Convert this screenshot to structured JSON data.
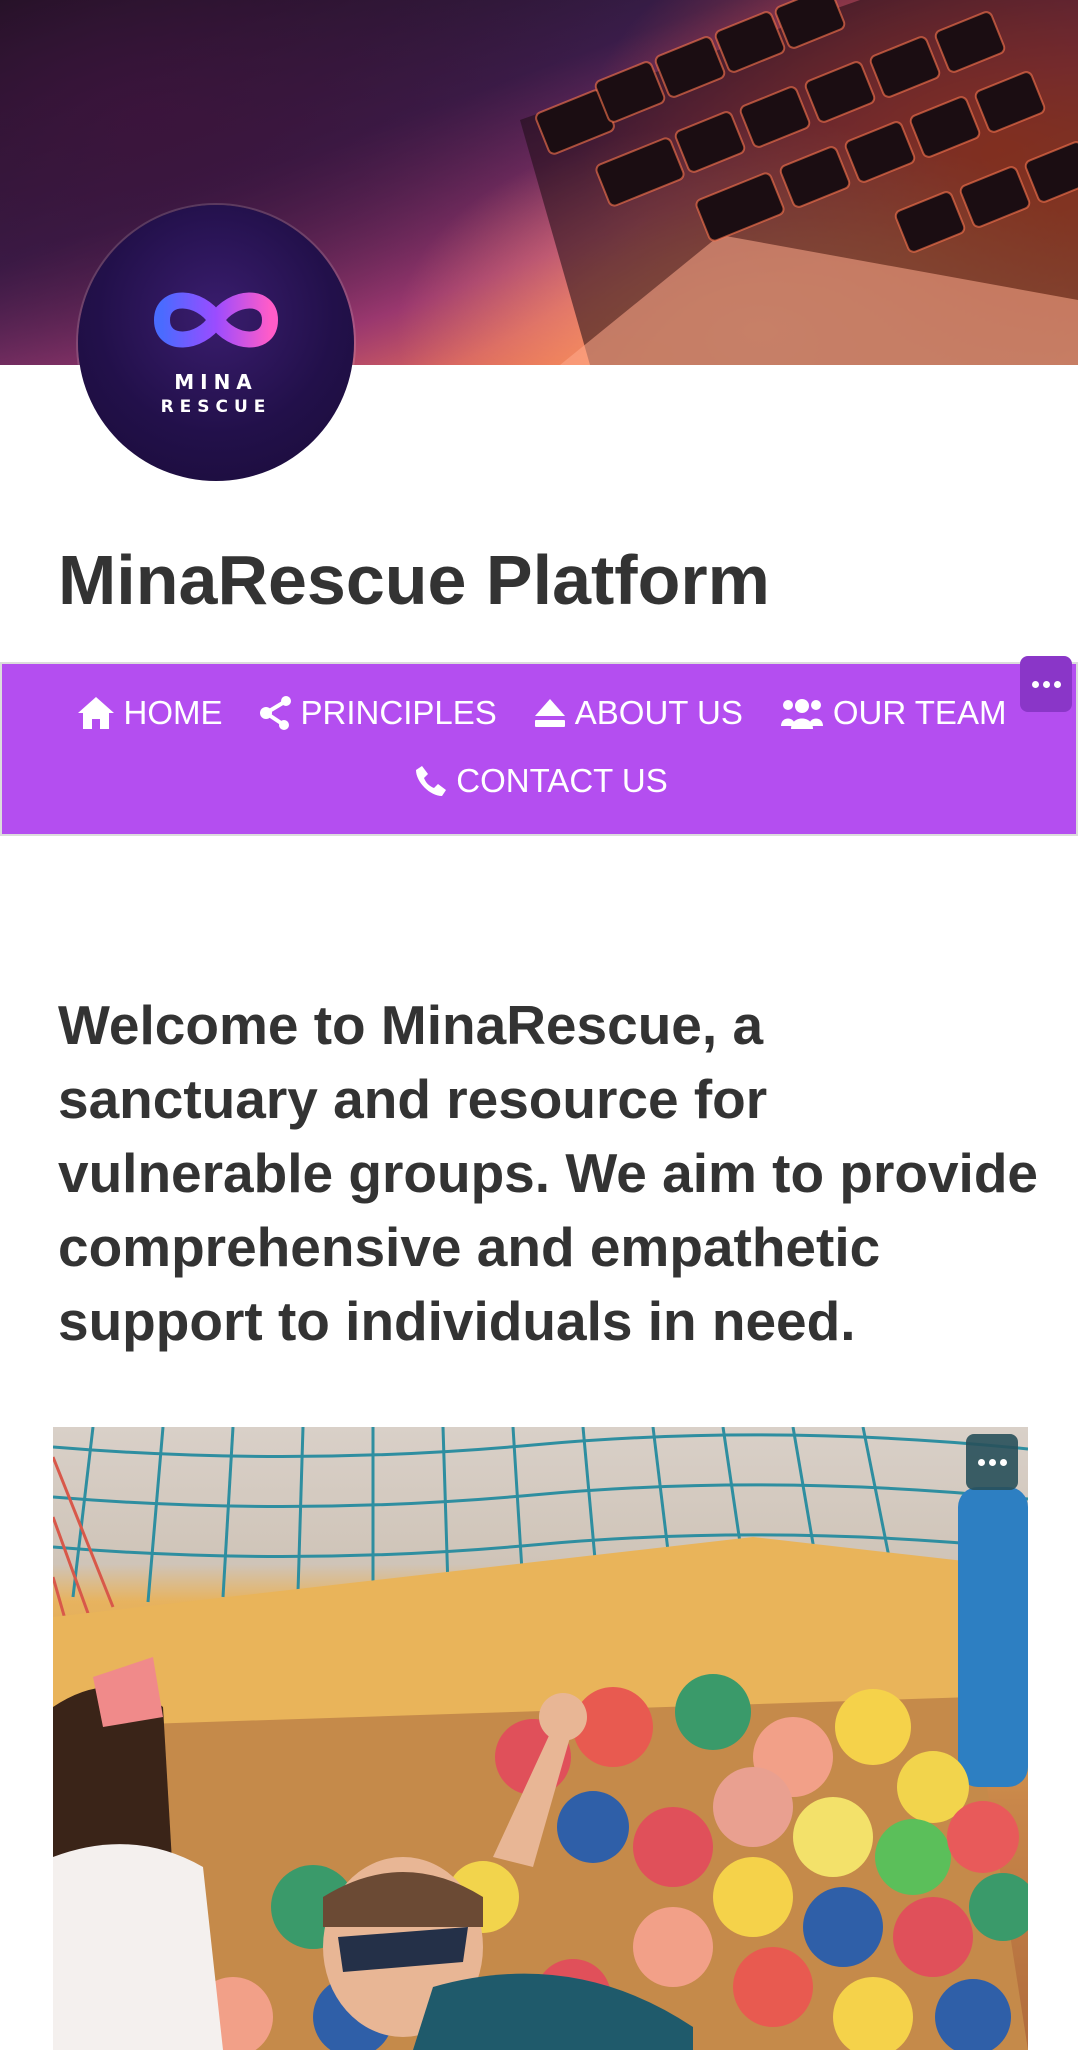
{
  "site": {
    "title": "MinaRescue Platform",
    "logo_line1": "MINA",
    "logo_line2": "RESCUE"
  },
  "nav": {
    "items": [
      {
        "label": "HOME",
        "icon": "home-icon"
      },
      {
        "label": "PRINCIPLES",
        "icon": "share-nodes-icon"
      },
      {
        "label": "ABOUT US",
        "icon": "eject-icon"
      },
      {
        "label": "OUR TEAM",
        "icon": "users-icon"
      },
      {
        "label": "CONTACT US",
        "icon": "phone-icon"
      }
    ],
    "more_icon": "ellipsis-icon"
  },
  "intro": {
    "text": "Welcome to MinaRescue, a sanctuary and resource for vulnerable groups. We aim to provide comprehensive and empathetic support to individuals in need."
  },
  "colors": {
    "nav_background": "#b44ef0",
    "text": "#333333",
    "background": "#ffffff"
  }
}
